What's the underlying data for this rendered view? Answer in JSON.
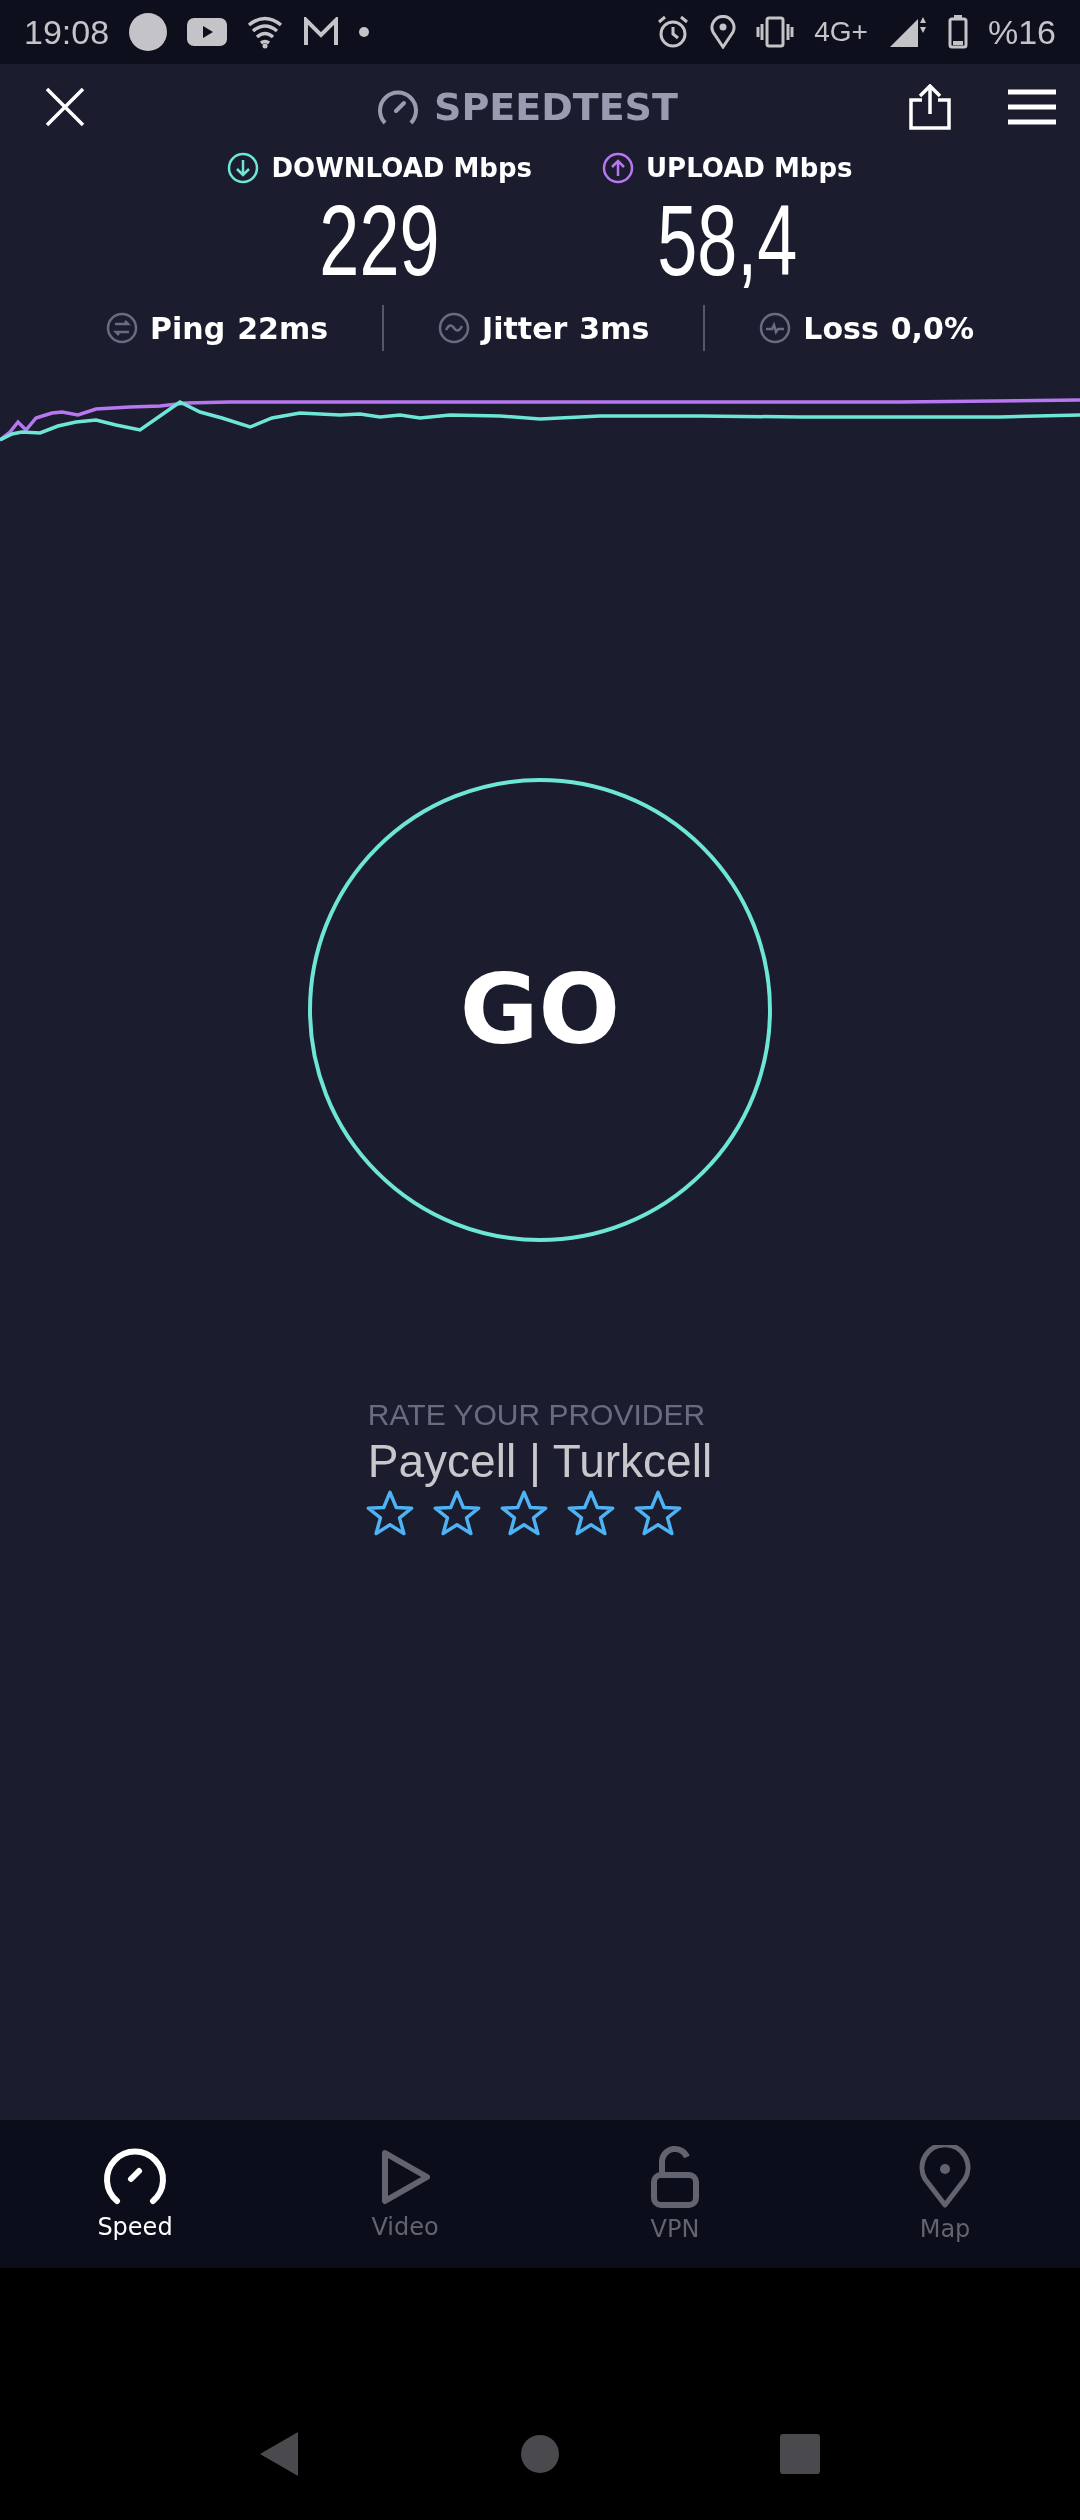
{
  "status_bar": {
    "time": "19:08",
    "network": "4G+",
    "battery": "%16"
  },
  "app_bar": {
    "title": "SPEEDTEST"
  },
  "results": [
    {
      "kind": "download",
      "label": "DOWNLOAD Mbps",
      "value": "229"
    },
    {
      "kind": "upload",
      "label": "UPLOAD Mbps",
      "value": "58,4"
    }
  ],
  "stats": [
    {
      "kind": "ping",
      "label": "Ping",
      "value": "22ms"
    },
    {
      "kind": "jitter",
      "label": "Jitter",
      "value": "3ms"
    },
    {
      "kind": "loss",
      "label": "Loss",
      "value": "0,0%"
    }
  ],
  "go_button": {
    "label": "GO"
  },
  "rating": {
    "prompt": "RATE YOUR PROVIDER",
    "provider": "Paycell | Turkcell",
    "stars": 0
  },
  "tabs": [
    {
      "label": "Speed",
      "selected": true
    },
    {
      "label": "Video",
      "selected": false
    },
    {
      "label": "VPN",
      "selected": false
    },
    {
      "label": "Map",
      "selected": false
    }
  ]
}
